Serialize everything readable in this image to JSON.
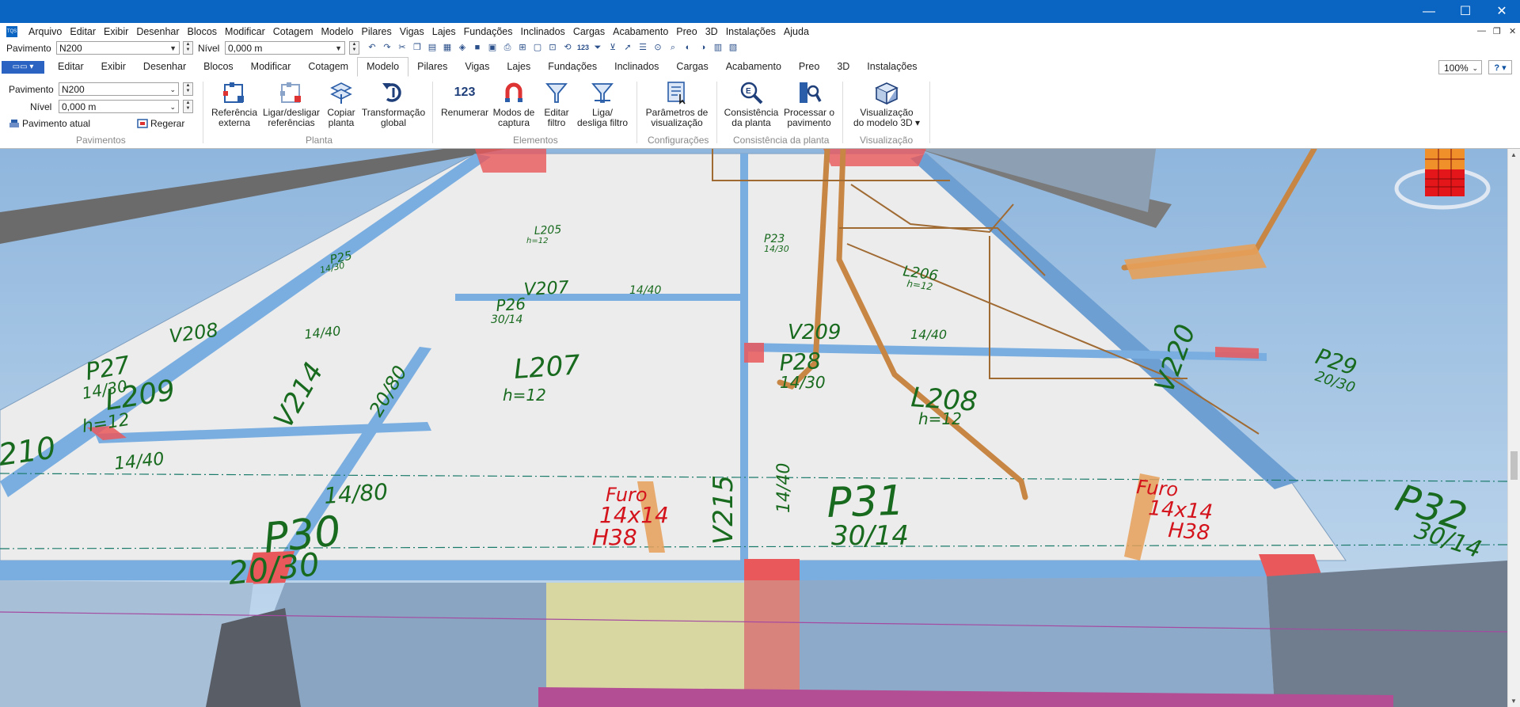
{
  "window": {
    "title": "",
    "controls": {
      "minimize": "—",
      "maximize": "☐",
      "close": "✕"
    }
  },
  "app_icon": "TQS",
  "menu": [
    "Arquivo",
    "Editar",
    "Exibir",
    "Desenhar",
    "Blocos",
    "Modificar",
    "Cotagem",
    "Modelo",
    "Pilares",
    "Vigas",
    "Lajes",
    "Fundações",
    "Inclinados",
    "Cargas",
    "Acabamento",
    "Preo",
    "3D",
    "Instalações",
    "Ajuda"
  ],
  "quick": {
    "pavimento_label": "Pavimento",
    "pavimento_value": "N200",
    "nivel_label": "Nível",
    "nivel_value": "0,000 m"
  },
  "tabs": [
    "Editar",
    "Exibir",
    "Desenhar",
    "Blocos",
    "Modificar",
    "Cotagem",
    "Modelo",
    "Pilares",
    "Vigas",
    "Lajes",
    "Fundações",
    "Inclinados",
    "Cargas",
    "Acabamento",
    "Preo",
    "3D",
    "Instalações"
  ],
  "active_tab": "Modelo",
  "zoom": "100%",
  "help": "?",
  "ribbon": {
    "pavimentos": {
      "label": "Pavimentos",
      "pavimento_label": "Pavimento",
      "pavimento_value": "N200",
      "nivel_label": "Nível",
      "nivel_value": "0,000 m",
      "pavimento_atual": "Pavimento atual",
      "regerar": "Regerar"
    },
    "planta": {
      "label": "Planta",
      "referencia_externa": [
        "Referência",
        "externa"
      ],
      "ligar_desligar": [
        "Ligar/desligar",
        "referências"
      ],
      "copiar_planta": [
        "Copiar",
        "planta"
      ],
      "transformacao_global": [
        "Transformação",
        "global"
      ]
    },
    "elementos": {
      "label": "Elementos",
      "renumerar": "Renumerar",
      "renumerar_icon_text": "123",
      "modos_captura": [
        "Modos de",
        "captura"
      ],
      "editar_filtro": [
        "Editar",
        "filtro"
      ],
      "liga_desliga_filtro": [
        "Liga/",
        "desliga filtro"
      ]
    },
    "configuracoes": {
      "label": "Configurações",
      "parametros": [
        "Parâmetros de",
        "visualização"
      ]
    },
    "consistencia": {
      "label": "Consistência da planta",
      "consistencia_planta": [
        "Consistência",
        "da planta"
      ],
      "processar": [
        "Processar o",
        "pavimento"
      ]
    },
    "visualizacao": {
      "label": "Visualização",
      "visualizacao_3d": [
        "Visualização",
        "do modelo 3D ▾"
      ]
    }
  },
  "model_labels": {
    "v208": "V208",
    "v208_dim": "14/40",
    "p27": "P27",
    "p27_dim": "14/30",
    "l209": "L209",
    "l209_h": "h=12",
    "v214": "V214",
    "v214_dim": "20/80",
    "v210": "210",
    "v210_dim": "14/40",
    "l207": "L207",
    "l207_h": "h=12",
    "v207": "V207",
    "v207_dim": "14/40",
    "p26": "P26",
    "p26_dim": "30/14",
    "p25": "P25",
    "p25_dim": "14/30",
    "l205": "L205",
    "l205_h": "h=12",
    "v215": "V215",
    "v215_dim": "14/40",
    "v209": "V209",
    "v209_dim": "14/40",
    "p28": "P28",
    "p28_dim": "14/30",
    "l208": "L208",
    "l208_h": "h=12",
    "p23": "P23",
    "p23_dim": "14/30",
    "l206": "L206",
    "l206_h": "h=12",
    "v220": "V220",
    "p29": "P29",
    "p29_dim": "20/30",
    "p30": "P30",
    "p30_dim": "20/30",
    "beam_14_80": "14/80",
    "p31": "P31",
    "p31_dim": "30/14",
    "p32": "P32",
    "p32_dim": "30/14",
    "furo1": [
      "Furo",
      "14x14",
      "H38"
    ],
    "furo2": [
      "Furo",
      "14x14",
      "H38"
    ]
  },
  "colors": {
    "titlebar": "#0a64c2",
    "sky": "#a9c9e6",
    "slab": "#ececec",
    "beam": "#7aaee0",
    "column": "#e9585a",
    "label_green": "#186a1e",
    "label_red": "#d4141c",
    "pipe": "#e6a05a",
    "magenta": "#b34d94"
  }
}
